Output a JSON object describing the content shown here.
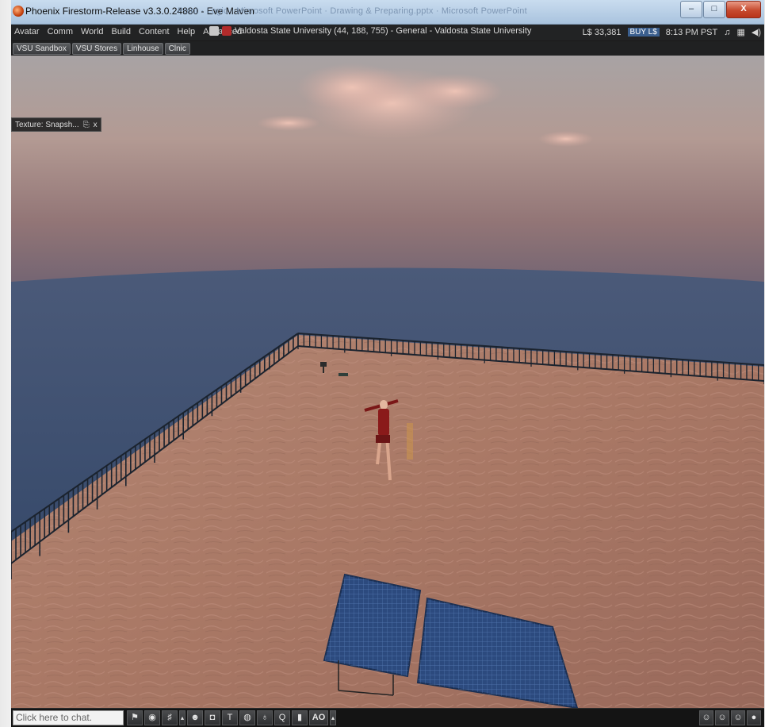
{
  "window": {
    "title": "Phoenix Firestorm-Release v3.3.0.24880 - Eve Maven",
    "background_title": "Point · Logic · Microsoft PowerPoint · Drawing & Preparing.pptx · Microsoft PowerPoint",
    "buttons": {
      "minimize": "–",
      "maximize": "□",
      "close": "X"
    }
  },
  "menubar": {
    "items": [
      "Avatar",
      "Comm",
      "World",
      "Build",
      "Content",
      "Help",
      "Advanced"
    ],
    "location": "Valdosta State University (44, 188, 755) - General - Valdosta State University",
    "balance": "L$ 33,381",
    "buy_label": "BUY L$",
    "time": "8:13 PM PST",
    "status_icons": [
      "music-icon",
      "media-icon",
      "volume-icon"
    ]
  },
  "favorites": [
    "VSU Sandbox",
    "VSU Stores",
    "Linhouse",
    "Clnic"
  ],
  "floater": {
    "title": "Texture: Snapsh...",
    "close": "x",
    "pin": "⎘"
  },
  "chat": {
    "placeholder": "Click here to chat."
  },
  "toolbar": {
    "ao_label": "AO",
    "buttons": [
      "gesture-icon",
      "voice-icon",
      "mic-icon",
      "expand-icon",
      "people-icon",
      "snapshot-icon",
      "build-icon",
      "map-icon",
      "search-ring-icon",
      "search-icon",
      "inventory-icon"
    ]
  },
  "colors": {
    "sky_top": "#bca59c",
    "sky_mid": "#8a7070",
    "water": "#3e5474",
    "sand": "#ad7c6c",
    "fence": "#1d2530",
    "panel": "#2c4a7e",
    "avatar_top": "#8a1a1a"
  }
}
